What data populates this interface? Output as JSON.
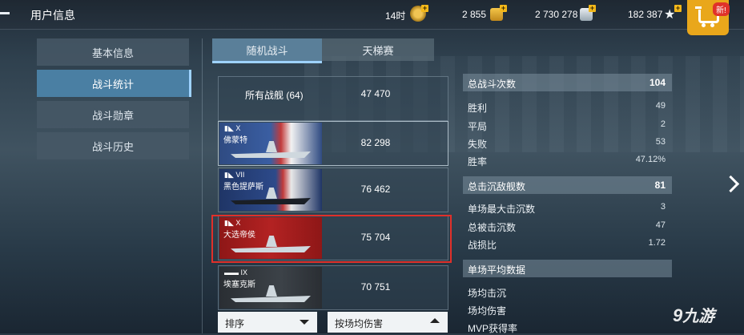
{
  "header": {
    "title": "用户信息",
    "resources": [
      {
        "value": "14时",
        "icon": "premium-time-icon"
      },
      {
        "value": "2 855",
        "icon": "gold-icon"
      },
      {
        "value": "2 730 278",
        "icon": "silver-icon"
      },
      {
        "value": "182 387",
        "icon": "free-xp-star-icon"
      }
    ],
    "shop_badge": "新!"
  },
  "sidebar": {
    "items": [
      {
        "label": "基本信息",
        "active": false
      },
      {
        "label": "战斗统计",
        "active": true
      },
      {
        "label": "战斗勋章",
        "active": false
      },
      {
        "label": "战斗历史",
        "active": false
      }
    ]
  },
  "tabs": [
    {
      "label": "随机战斗",
      "active": true
    },
    {
      "label": "天梯赛",
      "active": false
    }
  ],
  "ships": {
    "all": {
      "label": "所有战舰 (64)",
      "value": "47 470"
    },
    "list": [
      {
        "tier": "X",
        "name": "佛蒙特",
        "value": "82 298",
        "flag": "usa"
      },
      {
        "tier": "VII",
        "name": "黑色提萨斯",
        "value": "76 462",
        "flag": "usa"
      },
      {
        "tier": "X",
        "name": "大选帝侯",
        "value": "75 704",
        "flag": "germany"
      },
      {
        "tier": "IX",
        "name": "埃塞克斯",
        "value": "70 751",
        "flag": "usa"
      }
    ]
  },
  "controls": {
    "sort_label": "排序",
    "sort_by_label": "按场均伤害"
  },
  "stats": {
    "total_battles": {
      "label": "总战斗次数",
      "value": "104"
    },
    "battle_rows": [
      {
        "label": "胜利",
        "value": "49"
      },
      {
        "label": "平局",
        "value": "2"
      },
      {
        "label": "失败",
        "value": "53"
      },
      {
        "label": "胜率",
        "value": "47.12%"
      }
    ],
    "total_kills": {
      "label": "总击沉敌舰数",
      "value": "81"
    },
    "kill_rows": [
      {
        "label": "单场最大击沉数",
        "value": "3"
      },
      {
        "label": "总被击沉数",
        "value": "47"
      },
      {
        "label": "战损比",
        "value": "1.72"
      }
    ],
    "avg_header": {
      "label": "单场平均数据"
    },
    "avg_rows": [
      {
        "label": "场均击沉"
      },
      {
        "label": "场均伤害"
      },
      {
        "label": "MVP获得率"
      }
    ]
  },
  "watermark": {
    "symbol": "9",
    "text": "九游"
  },
  "colors": {
    "accent": "#4a7fa3",
    "highlight": "#e0302a",
    "gold": "#e9a71b"
  }
}
